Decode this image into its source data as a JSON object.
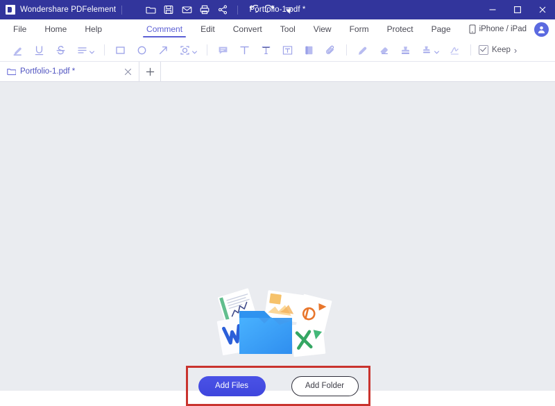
{
  "titlebar": {
    "app_name": "Wondershare PDFelement",
    "document_title": "Portfolio-1.pdf *",
    "logo_icon": "pdfelement-logo-icon",
    "quick_actions": [
      {
        "name": "open-file-icon",
        "tooltip": "Open"
      },
      {
        "name": "save-icon",
        "tooltip": "Save"
      },
      {
        "name": "email-icon",
        "tooltip": "Email"
      },
      {
        "name": "print-icon",
        "tooltip": "Print"
      },
      {
        "name": "share-icon",
        "tooltip": "Share"
      },
      {
        "name": "undo-icon",
        "tooltip": "Undo"
      },
      {
        "name": "redo-icon",
        "tooltip": "Redo"
      },
      {
        "name": "customize-dropdown-icon",
        "tooltip": "Customize"
      }
    ],
    "window_controls": {
      "minimize": "minimize-icon",
      "maximize": "maximize-icon",
      "close": "close-icon"
    }
  },
  "menubar": {
    "items": [
      {
        "label": "File",
        "active": false
      },
      {
        "label": "Home",
        "active": false
      },
      {
        "label": "Help",
        "active": false
      },
      {
        "label": "Comment",
        "active": true
      },
      {
        "label": "Edit",
        "active": false
      },
      {
        "label": "Convert",
        "active": false
      },
      {
        "label": "Tool",
        "active": false
      },
      {
        "label": "View",
        "active": false
      },
      {
        "label": "Form",
        "active": false
      },
      {
        "label": "Protect",
        "active": false
      },
      {
        "label": "Page",
        "active": false
      }
    ],
    "mobile_link": "iPhone / iPad",
    "mobile_icon": "phone-icon",
    "avatar_icon": "user-avatar-icon",
    "accent_color": "#5b5fd4"
  },
  "ribbon": {
    "tools": [
      {
        "name": "highlight-icon",
        "label": "Highlight"
      },
      {
        "name": "underline-icon",
        "label": "Underline"
      },
      {
        "name": "strikethrough-icon",
        "label": "Strikethrough"
      },
      {
        "name": "squiggly-lines-icon",
        "label": "Squiggly",
        "dropdown": true
      },
      {
        "name": "rectangle-icon",
        "label": "Rectangle"
      },
      {
        "name": "ellipse-icon",
        "label": "Ellipse"
      },
      {
        "name": "arrow-icon",
        "label": "Arrow"
      },
      {
        "name": "area-highlight-icon",
        "label": "Area Highlight",
        "dropdown": true
      },
      {
        "name": "comment-bubble-icon",
        "label": "Note"
      },
      {
        "name": "text-comment-icon",
        "label": "Text Comment"
      },
      {
        "name": "typewriter-icon",
        "label": "Typewriter"
      },
      {
        "name": "textbox-icon",
        "label": "Text Box"
      },
      {
        "name": "sticky-note-icon",
        "label": "Sticky Note"
      },
      {
        "name": "attachment-icon",
        "label": "Attachment"
      },
      {
        "name": "pencil-icon",
        "label": "Pencil"
      },
      {
        "name": "eraser-icon",
        "label": "Eraser"
      },
      {
        "name": "stamp-icon",
        "label": "Stamp"
      },
      {
        "name": "custom-stamp-icon",
        "label": "Custom Stamp",
        "dropdown": true
      },
      {
        "name": "signature-icon",
        "label": "Signature"
      }
    ],
    "keep_label": "Keep",
    "keep_checked": true,
    "overflow_label": "›"
  },
  "tabstrip": {
    "tabs": [
      {
        "label": "Portfolio-1.pdf *",
        "icon": "folder-tab-icon",
        "close_icon": "close-tab-icon",
        "active": true
      }
    ],
    "new_tab_label": "+"
  },
  "canvas": {
    "background_color": "#eaecf0",
    "illustration": {
      "name": "portfolio-folder-illustration",
      "folder_color": "#3aa0f5",
      "cards": [
        {
          "name": "chart-document-card",
          "glyph": ""
        },
        {
          "name": "word-document-card",
          "glyph": "W",
          "color": "#2b5fd9"
        },
        {
          "name": "image-document-card",
          "glyph": ""
        },
        {
          "name": "powerpoint-document-card",
          "glyph": "P",
          "color": "#e8762c"
        },
        {
          "name": "excel-document-card",
          "glyph": "X",
          "color": "#35a663"
        }
      ]
    },
    "actions": {
      "add_files_label": "Add Files",
      "add_folder_label": "Add Folder",
      "primary_color": "#4050e0",
      "annotation_color": "#c9332e"
    }
  }
}
